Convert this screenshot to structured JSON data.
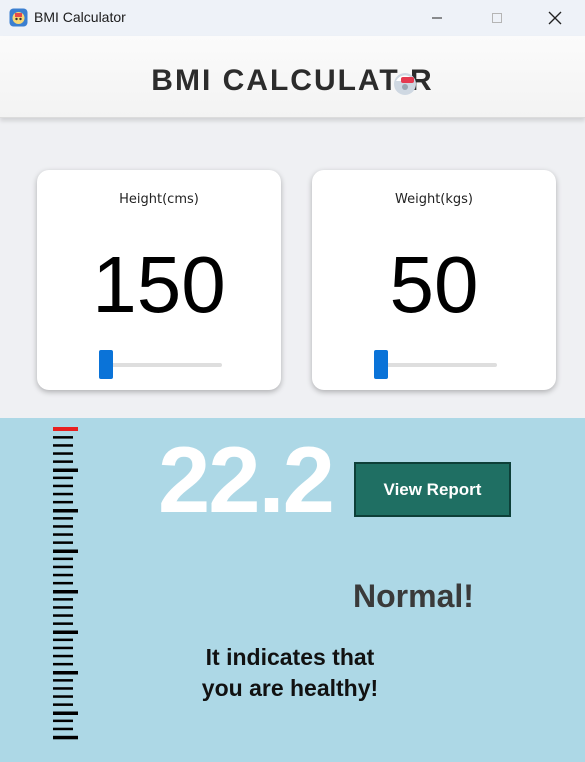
{
  "window": {
    "title": "BMI Calculator",
    "icon": "app-icon",
    "controls": [
      "minimize-icon",
      "maximize-icon",
      "close-icon"
    ]
  },
  "header": {
    "title": "BMI CALCULAT R",
    "logo_icon": "scale-logo-icon"
  },
  "height_card": {
    "label": "Height(cms)",
    "value": "150",
    "slider_fraction": 0.0
  },
  "weight_card": {
    "label": "Weight(kgs)",
    "value": "50",
    "slider_fraction": 0.0
  },
  "result": {
    "bmi": "22.2",
    "report_button": "View Report",
    "status": "Normal!",
    "message_line1": "It indicates that",
    "message_line2": "you are healthy!"
  },
  "colors": {
    "result_bg": "#add8e6",
    "button_bg": "#1f6f63",
    "slider_thumb": "#0a73d8",
    "scale_marker": "#e82020"
  }
}
